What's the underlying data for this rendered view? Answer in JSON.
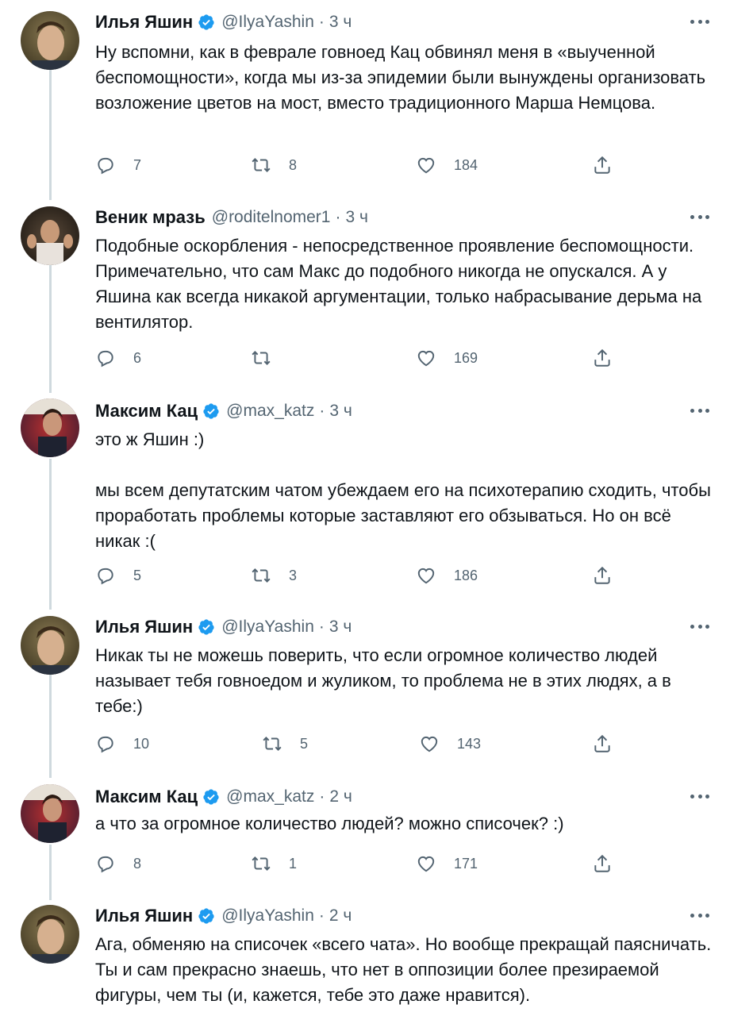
{
  "tweets": [
    {
      "name": "Илья Яшин",
      "handle": "@IlyaYashin",
      "time": "3 ч",
      "verified": true,
      "text": "Ну вспомни, как в феврале говноед Кац обвинял меня в «выученной беспомощности», когда мы из-за эпидемии были вынуждены организовать возложение цветов на мост, вместо традиционного Марша Немцова.",
      "replies": "7",
      "retweets": "8",
      "likes": "184"
    },
    {
      "name": "Веник мразь",
      "handle": "@roditelnomer1",
      "time": "3 ч",
      "verified": false,
      "text": "Подобные оскорбления - непосредственное проявление беспомощности. Примечательно, что сам Макс до подобного никогда не опускался. А у Яшина как всегда никакой аргументации, только набрасывание дерьма на вентилятор.",
      "replies": "6",
      "retweets": "",
      "likes": "169"
    },
    {
      "name": "Максим Кац",
      "handle": "@max_katz",
      "time": "3 ч",
      "verified": true,
      "text": "это ж Яшин :)\n\nмы всем депутатским чатом убеждаем его на психотерапию сходить, чтобы проработать проблемы которые заставляют его обзываться. Но он всё никак :(",
      "replies": "5",
      "retweets": "3",
      "likes": "186"
    },
    {
      "name": "Илья Яшин",
      "handle": "@IlyaYashin",
      "time": "3 ч",
      "verified": true,
      "text": "Никак ты не можешь поверить, что если огромное количество людей называет тебя говноедом и жуликом, то проблема не в этих людях, а в тебе:)",
      "replies": "10",
      "retweets": "5",
      "likes": "143"
    },
    {
      "name": "Максим Кац",
      "handle": "@max_katz",
      "time": "2 ч",
      "verified": true,
      "text": "а что за огромное количество людей? можно списочек? :)",
      "replies": "8",
      "retweets": "1",
      "likes": "171"
    },
    {
      "name": "Илья Яшин",
      "handle": "@IlyaYashin",
      "time": "2 ч",
      "verified": true,
      "text": "Ага, обменяю на списочек «всего чата». Но вообще прекращай паясничать. Ты и сам прекрасно знаешь, что нет в оппозиции более презираемой фигуры, чем ты (и, кажется, тебе это даже нравится).",
      "replies": "",
      "retweets": "",
      "likes": ""
    }
  ],
  "colors": {
    "verified": "#1d9bf0",
    "muted": "#536471",
    "thread_line": "#cfd9de"
  },
  "icons": {
    "reply": "reply-icon",
    "retweet": "retweet-icon",
    "like": "like-icon",
    "share": "share-icon",
    "more": "more-icon",
    "verified": "verified-badge-icon"
  }
}
